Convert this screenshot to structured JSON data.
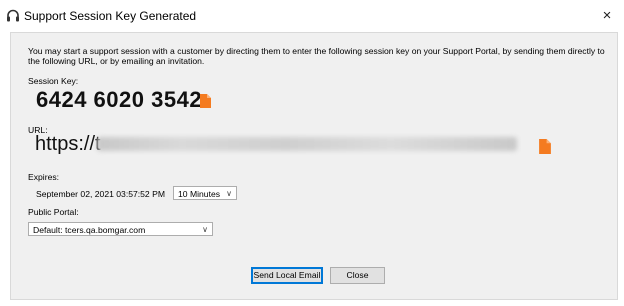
{
  "window": {
    "title": "Support Session Key Generated",
    "close_glyph": "×"
  },
  "intro_text": "You may start a support session with a customer by directing them to enter the following session key on your Support Portal, by sending them directly to the following URL, or by emailing an invitation.",
  "session_key": {
    "label": "Session Key:",
    "value": "6424 6020 3542"
  },
  "url": {
    "label": "URL:",
    "value_prefix": "https://t"
  },
  "expires": {
    "label": "Expires:",
    "datetime": "September 02, 2021 03:57:52 PM",
    "duration_selected": "10 Minutes"
  },
  "public_portal": {
    "label": "Public Portal:",
    "selected": "Default: tcers.qa.bomgar.com"
  },
  "buttons": {
    "send_local_email": "Send Local Email",
    "close": "Close"
  },
  "colors": {
    "accent": "#0078d7",
    "copy_icon": "#f47b20",
    "panel_bg": "#f0f0f0"
  },
  "icons": {
    "app": "headset-icon",
    "copy": "copy-icon",
    "chevron": "chevron-down-icon"
  }
}
